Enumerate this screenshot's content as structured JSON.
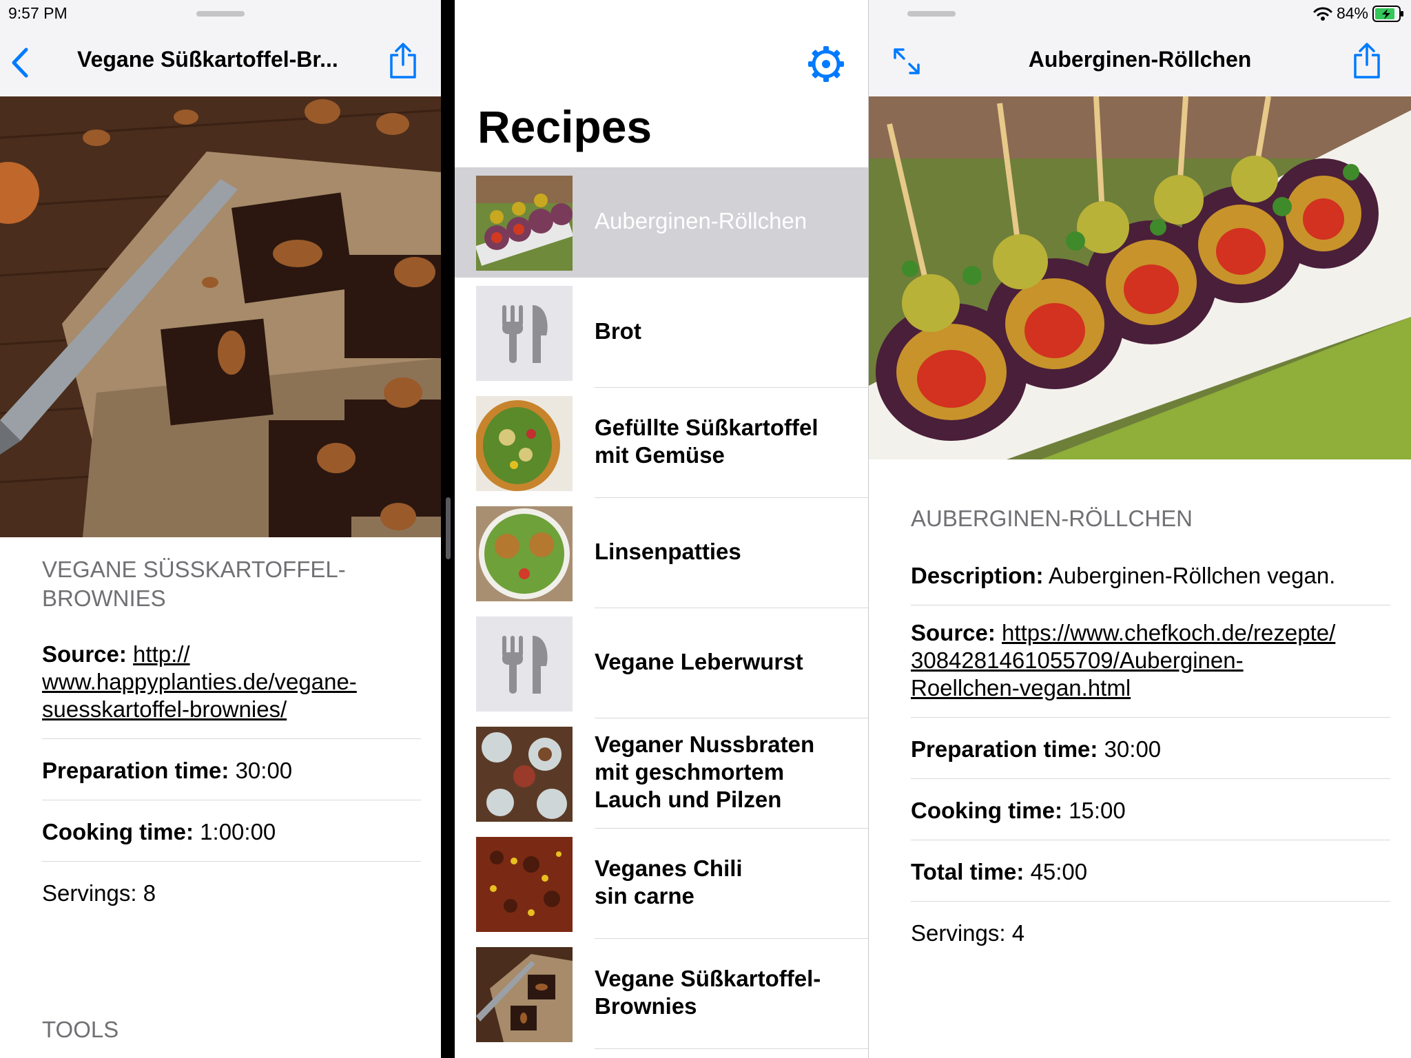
{
  "status_bar": {
    "time": "9:57 PM",
    "battery": "84%"
  },
  "left_pane": {
    "nav_title": "Vegane Süßkartoffel-Br...",
    "section_title": "VEGANE SÜSSKARTOFFEL-\nBROWNIES",
    "source_label": "Source:",
    "source_value": "http://\nwww.happyplanties.de/vegane-\nsuesskartoffel-brownies/",
    "prep_label": "Preparation time:",
    "prep_value": "30:00",
    "cook_label": "Cooking time:",
    "cook_value": "1:00:00",
    "servings_label": "Servings:",
    "servings_value": "8",
    "tools_title": "TOOLS"
  },
  "middle_pane": {
    "title": "Recipes",
    "items": [
      {
        "label": "Auberginen-Röllchen",
        "thumb": "eggplant-rolls",
        "selected": true
      },
      {
        "label": "Brot",
        "thumb": "fork-knife-icon"
      },
      {
        "label": "Gefüllte Süßkartoffel\nmit Gemüse",
        "thumb": "stuffed-sweet-potato"
      },
      {
        "label": "Linsenpatties",
        "thumb": "lentil-patties"
      },
      {
        "label": "Vegane Leberwurst",
        "thumb": "fork-knife-icon"
      },
      {
        "label": "Veganer Nussbraten\nmit geschmortem\nLauch und Pilzen",
        "thumb": "nut-roast"
      },
      {
        "label": "Veganes Chili\nsin carne",
        "thumb": "chili"
      },
      {
        "label": "Vegane Süßkartoffel-\nBrownies",
        "thumb": "brownies"
      }
    ]
  },
  "right_pane": {
    "nav_title": "Auberginen-Röllchen",
    "section_title": "AUBERGINEN-RÖLLCHEN",
    "desc_label": "Description:",
    "desc_value": "Auberginen-Röllchen vegan.",
    "source_label": "Source:",
    "source_value": "https://www.chefkoch.de/rezepte/\n3084281461055709/Auberginen-\nRoellchen-vegan.html",
    "prep_label": "Preparation time:",
    "prep_value": "30:00",
    "cook_label": "Cooking time:",
    "cook_value": "15:00",
    "total_label": "Total time:",
    "total_value": "45:00",
    "servings_label": "Servings:",
    "servings_value": "4"
  },
  "colors": {
    "accent": "#007aff",
    "selected_row": "#d1d1d6",
    "secondary_text": "#707074"
  }
}
